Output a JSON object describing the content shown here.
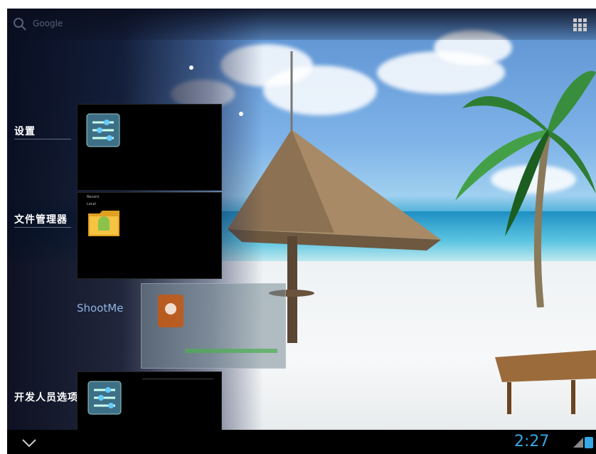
{
  "search": {
    "hint": "Google"
  },
  "recent_apps": [
    {
      "label": "设置",
      "icon": "settings-icon"
    },
    {
      "label": "文件管理器",
      "icon": "folder-icon"
    },
    {
      "label": "ShootMe",
      "icon": "shootme-icon"
    },
    {
      "label": "开发人员选项",
      "icon": "settings-icon"
    }
  ],
  "status": {
    "time": "2:27"
  },
  "file_manager_thumb": {
    "lines": [
      "Recent",
      "Local"
    ]
  }
}
